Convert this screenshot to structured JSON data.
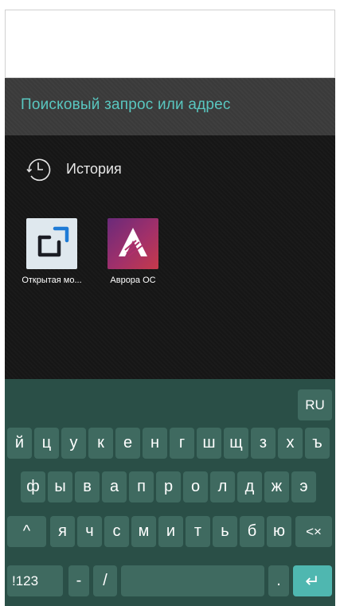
{
  "search": {
    "placeholder": "Поисковый запрос или адрес"
  },
  "history": {
    "label": "История",
    "icon": "history-clock-icon"
  },
  "tiles": [
    {
      "caption": "Открытая мо...",
      "icon": "open-mobile-platform-logo"
    },
    {
      "caption": "Аврора ОС",
      "icon": "aurora-os-logo"
    }
  ],
  "keyboard": {
    "language": "RU",
    "row1": [
      "й",
      "ц",
      "у",
      "к",
      "е",
      "н",
      "г",
      "ш",
      "щ",
      "з",
      "х",
      "ъ"
    ],
    "row2": [
      "ф",
      "ы",
      "в",
      "а",
      "п",
      "р",
      "о",
      "л",
      "д",
      "ж",
      "э"
    ],
    "row3": [
      "я",
      "ч",
      "с",
      "м",
      "и",
      "т",
      "ь",
      "б",
      "ю"
    ],
    "shift": "^",
    "backspace": "<×",
    "symbols": "!123",
    "dash": "-",
    "slash": "/",
    "dot": ".",
    "enter": "↵"
  },
  "colors": {
    "accent": "#59c7c0",
    "keyboard_bg": "#2a4f47",
    "key_bg": "#3f6a60",
    "enter_key": "#4fb7b0"
  }
}
